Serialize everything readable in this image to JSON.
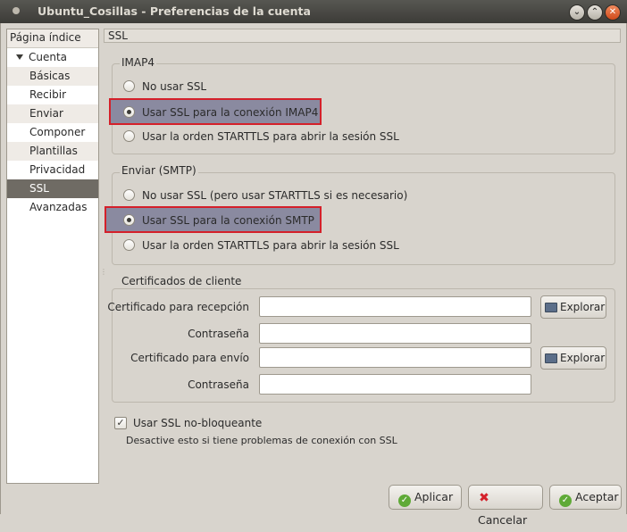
{
  "window": {
    "title": "Ubuntu_Cosillas - Preferencias de la cuenta",
    "controls": [
      "minimize",
      "maximize",
      "close"
    ]
  },
  "sidebar": {
    "header": "Página índice",
    "parent": "Cuenta",
    "items": [
      {
        "label": "Básicas"
      },
      {
        "label": "Recibir"
      },
      {
        "label": "Enviar"
      },
      {
        "label": "Componer"
      },
      {
        "label": "Plantillas"
      },
      {
        "label": "Privacidad"
      },
      {
        "label": "SSL"
      },
      {
        "label": "Avanzadas"
      }
    ],
    "selected": "SSL"
  },
  "section_header": "SSL",
  "imap": {
    "title": "IMAP4",
    "options": [
      {
        "label": "No usar SSL",
        "checked": false
      },
      {
        "label": "Usar SSL para la conexión IMAP4",
        "checked": true
      },
      {
        "label": "Usar la orden STARTTLS para abrir la sesión SSL",
        "checked": false
      }
    ]
  },
  "smtp": {
    "title": "Enviar (SMTP)",
    "options": [
      {
        "label": "No usar SSL (pero usar STARTTLS si es necesario)",
        "checked": false
      },
      {
        "label": "Usar SSL para la conexión SMTP",
        "checked": true
      },
      {
        "label": "Usar la orden STARTTLS para abrir la sesión SSL",
        "checked": false
      }
    ]
  },
  "certs": {
    "title": "Certificados de cliente",
    "receive_label": "Certificado para recepción",
    "receive_value": "",
    "receive_password_label": "Contraseña",
    "receive_password_value": "",
    "send_label": "Certificado para envío",
    "send_value": "",
    "send_password_label": "Contraseña",
    "send_password_value": "",
    "browse_label": "Explorar"
  },
  "nonblocking": {
    "label": "Usar SSL no-bloqueante",
    "checked": true,
    "hint": "Desactive esto si tiene problemas de conexión con SSL"
  },
  "buttons": {
    "apply": "Aplicar",
    "cancel": "Cancelar",
    "accept": "Aceptar"
  },
  "colors": {
    "highlight_border": "#d4202a",
    "selected_item": "#6f6b64",
    "ok_icon": "#5faa37"
  }
}
